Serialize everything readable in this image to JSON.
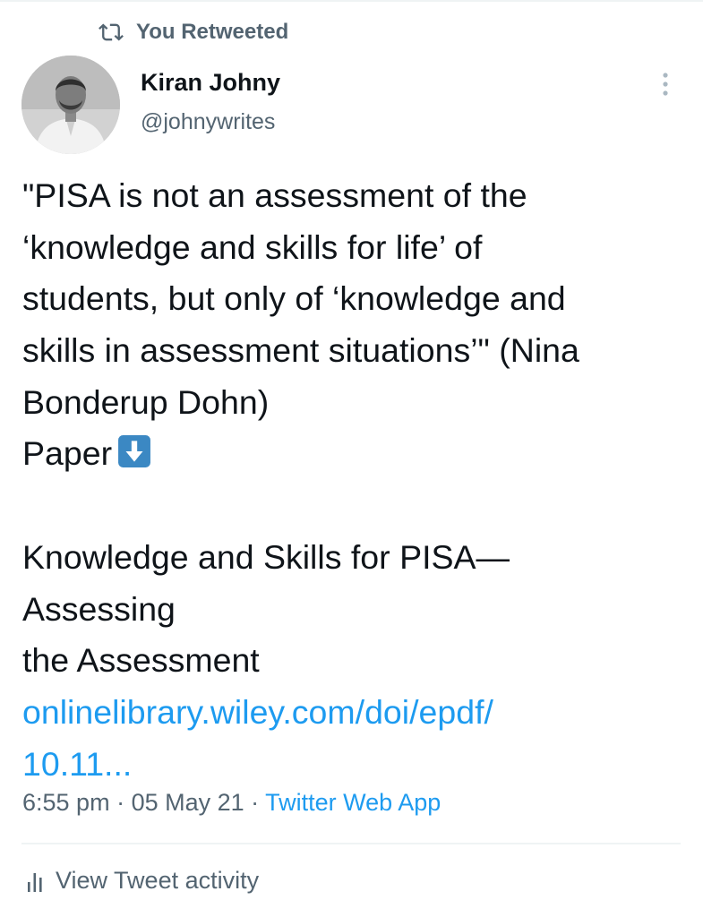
{
  "retweet_context": {
    "label": "You Retweeted",
    "icon": "retweet-icon"
  },
  "author": {
    "name": "Kiran Johny",
    "handle": "@johnywrites",
    "avatar_icon": "profile-photo"
  },
  "menu": {
    "icon": "more-vertical-icon"
  },
  "tweet": {
    "lines": [
      "\"PISA is not an assessment of the",
      "‘knowledge and skills for life’ of",
      "students, but only of ‘knowledge and",
      "skills in assessment situations’\" (Nina",
      "Bonderup Dohn)",
      "Paper"
    ],
    "paper_emoji": "down-arrow-emoji",
    "title_lines": [
      "Knowledge and Skills for PISA—",
      "Assessing",
      "the Assessment"
    ],
    "link_lines": [
      "onlinelibrary.wiley.com/doi/epdf/",
      "10.11..."
    ]
  },
  "meta": {
    "time": "6:55 pm",
    "separator": " · ",
    "date": "05 May 21",
    "app": "Twitter Web App"
  },
  "activity": {
    "label": "View Tweet activity",
    "icon": "analytics-bars-icon"
  },
  "colors": {
    "text": "#0f1419",
    "secondary": "#536471",
    "link": "#1d9bf0",
    "divider": "#eff3f4",
    "emoji_blue": "#3b88c3"
  }
}
